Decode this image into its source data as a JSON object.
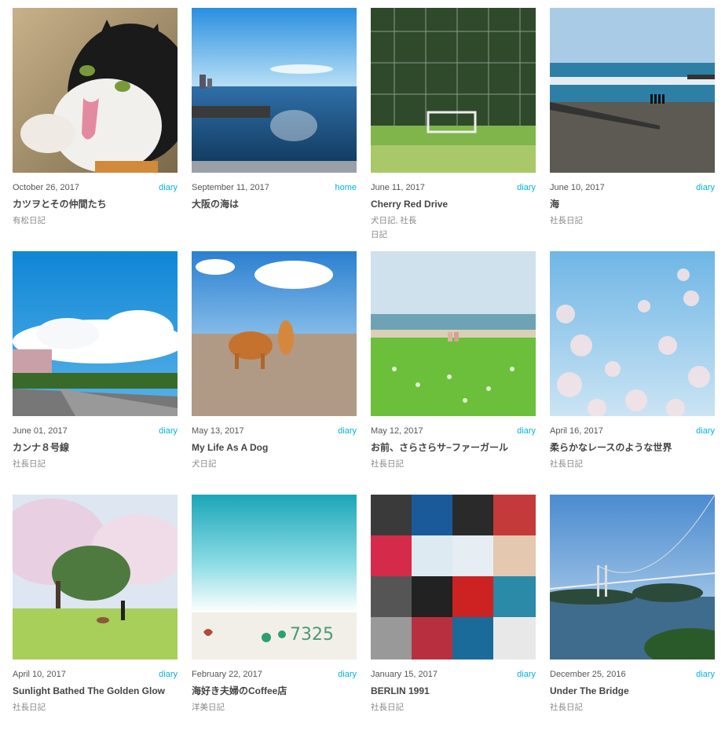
{
  "posts": [
    {
      "date": "October 26, 2017",
      "category": "diary",
      "title": "カツヲとその仲間たち",
      "tags": "有松日記",
      "image": "cat-licking-paw"
    },
    {
      "date": "September 11, 2017",
      "category": "home",
      "title": "大阪の海は",
      "tags": "",
      "image": "osaka-bay-sea"
    },
    {
      "date": "June 11, 2017",
      "category": "diary",
      "title": "Cherry Red Drive",
      "tags": "犬日記, 社長 日記",
      "image": "fence-field-goal"
    },
    {
      "date": "June 10, 2017",
      "category": "diary",
      "title": "海",
      "tags": "社長日記",
      "image": "beach-people"
    },
    {
      "date": "June 01, 2017",
      "category": "diary",
      "title": "カンナ８号線",
      "tags": "社長日記",
      "image": "road-clouds"
    },
    {
      "date": "May 13, 2017",
      "category": "diary",
      "title": "My Life As A Dog",
      "tags": "犬日記",
      "image": "dog-on-beach"
    },
    {
      "date": "May 12, 2017",
      "category": "diary",
      "title": "お前、さらさらサ−ファーガール",
      "tags": "社長日記",
      "image": "grass-beach-couple"
    },
    {
      "date": "April 16, 2017",
      "category": "diary",
      "title": "柔らかなレースのような世界",
      "tags": "社長日記",
      "image": "cherry-blossom-sky"
    },
    {
      "date": "April 10, 2017",
      "category": "diary",
      "title": "Sunlight Bathed The Golden Glow",
      "tags": "社長日記",
      "image": "park-cherry-trees"
    },
    {
      "date": "February 22, 2017",
      "category": "diary",
      "title": "海好き夫婦のCoffee店",
      "tags": "洋美日記",
      "image": "turquoise-sea-wall"
    },
    {
      "date": "January 15, 2017",
      "category": "diary",
      "title": "BERLIN 1991",
      "tags": "社長日記",
      "image": "album-collage"
    },
    {
      "date": "December 25, 2016",
      "category": "diary",
      "title": "Under The Bridge",
      "tags": "社長日記",
      "image": "suspension-bridge"
    }
  ]
}
